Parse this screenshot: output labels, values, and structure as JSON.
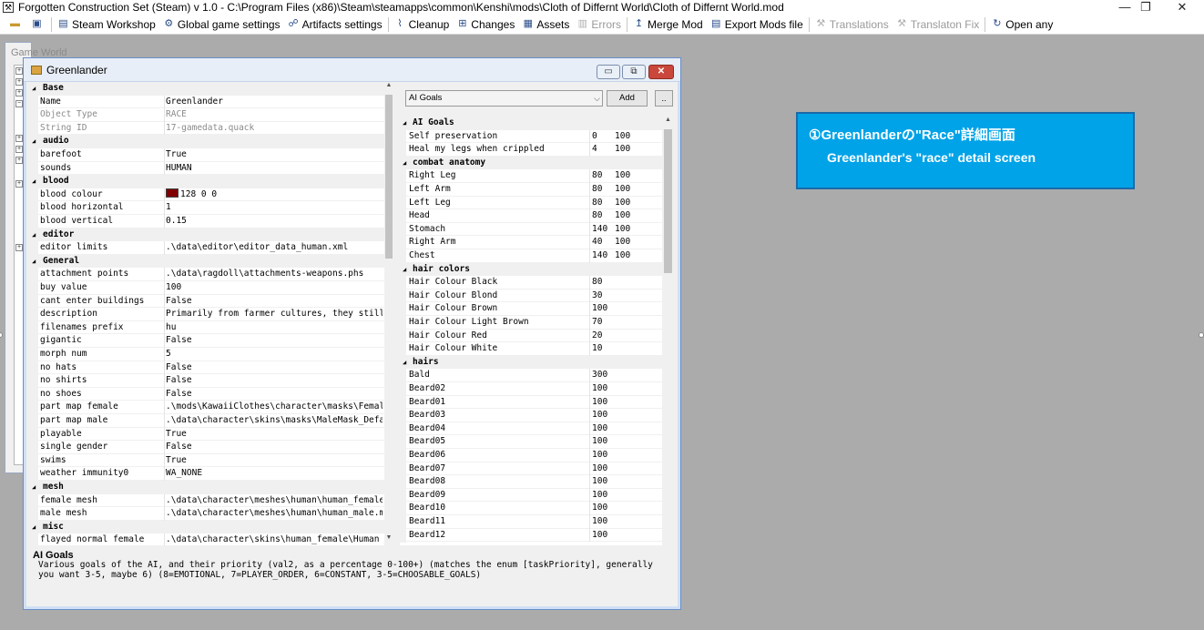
{
  "app": {
    "title": "Forgotten Construction Set (Steam) v 1.0 - C:\\Program Files (x86)\\Steam\\steamapps\\common\\Kenshi\\mods\\Cloth of Differnt World\\Cloth of Differnt World.mod"
  },
  "toolbar": {
    "items": [
      {
        "label": "Steam Workshop",
        "icon": "steam-icon",
        "enabled": true
      },
      {
        "label": "Global game settings",
        "icon": "gear-icon",
        "enabled": true
      },
      {
        "label": "Artifacts settings",
        "icon": "artifact-icon",
        "enabled": true
      },
      {
        "label": "Cleanup",
        "icon": "broom-icon",
        "enabled": true
      },
      {
        "label": "Changes",
        "icon": "changes-icon",
        "enabled": true
      },
      {
        "label": "Assets",
        "icon": "assets-icon",
        "enabled": true
      },
      {
        "label": "Errors",
        "icon": "errors-icon",
        "enabled": false
      },
      {
        "label": "Merge Mod",
        "icon": "merge-icon",
        "enabled": true
      },
      {
        "label": "Export Mods file",
        "icon": "export-icon",
        "enabled": true
      },
      {
        "label": "Translations",
        "icon": "translations-icon",
        "enabled": false
      },
      {
        "label": "Translaton Fix",
        "icon": "translation-fix-icon",
        "enabled": false
      },
      {
        "label": "Open any",
        "icon": "open-icon",
        "enabled": true
      }
    ]
  },
  "background_window": {
    "title": "Game World"
  },
  "window": {
    "title": "Greenlander",
    "left_grid": [
      {
        "type": "cat",
        "name": "Base"
      },
      {
        "type": "item",
        "name": "Name",
        "value": "Greenlander"
      },
      {
        "type": "item",
        "name": "Object Type",
        "value": "RACE",
        "disabled": true
      },
      {
        "type": "item",
        "name": "String ID",
        "value": "17-gamedata.quack",
        "disabled": true
      },
      {
        "type": "cat",
        "name": "audio"
      },
      {
        "type": "item",
        "name": "barefoot",
        "value": "True"
      },
      {
        "type": "item",
        "name": "sounds",
        "value": "HUMAN"
      },
      {
        "type": "cat",
        "name": "blood"
      },
      {
        "type": "item",
        "name": "blood colour",
        "value": "128 0 0",
        "swatch": "#800000"
      },
      {
        "type": "item",
        "name": "blood horizontal",
        "value": "1"
      },
      {
        "type": "item",
        "name": "blood vertical",
        "value": "0.15"
      },
      {
        "type": "cat",
        "name": "editor"
      },
      {
        "type": "item",
        "name": "editor limits",
        "value": ".\\data\\editor\\editor_data_human.xml"
      },
      {
        "type": "cat",
        "name": "General"
      },
      {
        "type": "item",
        "name": "attachment points",
        "value": ".\\data\\ragdoll\\attachments-weapons.phs"
      },
      {
        "type": "item",
        "name": "buy value",
        "value": "100"
      },
      {
        "type": "item",
        "name": "cant enter buildings",
        "value": "False"
      },
      {
        "type": "item",
        "name": "description",
        "value": "Primarily from farmer cultures, they still ter"
      },
      {
        "type": "item",
        "name": "filenames prefix",
        "value": "hu"
      },
      {
        "type": "item",
        "name": "gigantic",
        "value": "False"
      },
      {
        "type": "item",
        "name": "morph num",
        "value": "5"
      },
      {
        "type": "item",
        "name": "no hats",
        "value": "False"
      },
      {
        "type": "item",
        "name": "no shirts",
        "value": "False"
      },
      {
        "type": "item",
        "name": "no shoes",
        "value": "False"
      },
      {
        "type": "item",
        "name": "part map female",
        "value": ".\\mods\\KawaiiClothes\\character\\masks\\FemaleMas"
      },
      {
        "type": "item",
        "name": "part map male",
        "value": ".\\data\\character\\skins\\masks\\MaleMask_Default."
      },
      {
        "type": "item",
        "name": "playable",
        "value": "True"
      },
      {
        "type": "item",
        "name": "single gender",
        "value": "False"
      },
      {
        "type": "item",
        "name": "swims",
        "value": "True"
      },
      {
        "type": "item",
        "name": "weather immunity0",
        "value": "WA_NONE"
      },
      {
        "type": "cat",
        "name": "mesh"
      },
      {
        "type": "item",
        "name": "female mesh",
        "value": ".\\data\\character\\meshes\\human\\human_female.mes"
      },
      {
        "type": "item",
        "name": "male mesh",
        "value": ".\\data\\character\\meshes\\human\\human_male.mesh"
      },
      {
        "type": "cat",
        "name": "misc"
      },
      {
        "type": "item",
        "name": "flayed normal female",
        "value": ".\\data\\character\\skins\\human_female\\Human Fem"
      }
    ],
    "ai_selector": {
      "selected": "AI Goals",
      "add_label": "Add",
      "more_label": ".."
    },
    "right_grid": [
      {
        "type": "cat",
        "name": "AI Goals"
      },
      {
        "type": "item",
        "name": "Self preservation",
        "v1": "0",
        "v2": "100"
      },
      {
        "type": "item",
        "name": "Heal my legs when crippled",
        "v1": "4",
        "v2": "100"
      },
      {
        "type": "cat",
        "name": "combat anatomy"
      },
      {
        "type": "item",
        "name": "Right Leg",
        "v1": "80",
        "v2": "100"
      },
      {
        "type": "item",
        "name": "Left Arm",
        "v1": "80",
        "v2": "100"
      },
      {
        "type": "item",
        "name": "Left Leg",
        "v1": "80",
        "v2": "100"
      },
      {
        "type": "item",
        "name": "Head",
        "v1": "80",
        "v2": "100"
      },
      {
        "type": "item",
        "name": "Stomach",
        "v1": "140",
        "v2": "100"
      },
      {
        "type": "item",
        "name": "Right Arm",
        "v1": "40",
        "v2": "100"
      },
      {
        "type": "item",
        "name": "Chest",
        "v1": "140",
        "v2": "100"
      },
      {
        "type": "cat",
        "name": "hair colors"
      },
      {
        "type": "item",
        "name": "Hair Colour Black",
        "v1": "80",
        "v2": ""
      },
      {
        "type": "item",
        "name": "Hair Colour Blond",
        "v1": "30",
        "v2": ""
      },
      {
        "type": "item",
        "name": "Hair Colour Brown",
        "v1": "100",
        "v2": ""
      },
      {
        "type": "item",
        "name": "Hair Colour Light Brown",
        "v1": "70",
        "v2": ""
      },
      {
        "type": "item",
        "name": "Hair Colour Red",
        "v1": "20",
        "v2": ""
      },
      {
        "type": "item",
        "name": "Hair Colour White",
        "v1": "10",
        "v2": ""
      },
      {
        "type": "cat",
        "name": "hairs"
      },
      {
        "type": "item",
        "name": "Bald",
        "v1": "300",
        "v2": ""
      },
      {
        "type": "item",
        "name": "Beard02",
        "v1": "100",
        "v2": ""
      },
      {
        "type": "item",
        "name": "Beard01",
        "v1": "100",
        "v2": ""
      },
      {
        "type": "item",
        "name": "Beard03",
        "v1": "100",
        "v2": ""
      },
      {
        "type": "item",
        "name": "Beard04",
        "v1": "100",
        "v2": ""
      },
      {
        "type": "item",
        "name": "Beard05",
        "v1": "100",
        "v2": ""
      },
      {
        "type": "item",
        "name": "Beard06",
        "v1": "100",
        "v2": ""
      },
      {
        "type": "item",
        "name": "Beard07",
        "v1": "100",
        "v2": ""
      },
      {
        "type": "item",
        "name": "Beard08",
        "v1": "100",
        "v2": ""
      },
      {
        "type": "item",
        "name": "Beard09",
        "v1": "100",
        "v2": ""
      },
      {
        "type": "item",
        "name": "Beard10",
        "v1": "100",
        "v2": ""
      },
      {
        "type": "item",
        "name": "Beard11",
        "v1": "100",
        "v2": ""
      },
      {
        "type": "item",
        "name": "Beard12",
        "v1": "100",
        "v2": ""
      }
    ],
    "description": {
      "title": "AI Goals",
      "text": "Various goals of the AI, and their priority (val2, as a percentage 0-100+) (matches the enum [taskPriority], generally you want 3-5, maybe 6) (8=EMOTIONAL, 7=PLAYER_ORDER, 6=CONSTANT, 3-5=CHOOSABLE_GOALS)"
    }
  },
  "annotation": {
    "line1": "①Greenlanderの\"Race\"詳細画面",
    "line2": "Greenlander's \"race\" detail screen",
    "color": "#00a3e8"
  }
}
